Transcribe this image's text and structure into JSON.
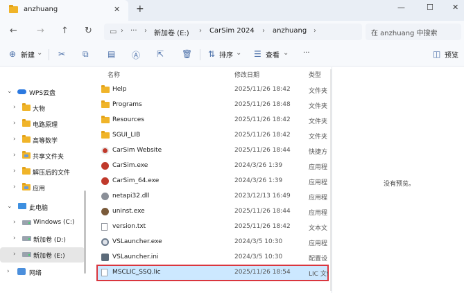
{
  "window": {
    "tab_title": "anzhuang",
    "close_tab": "✕",
    "new_tab": "+",
    "min": "—",
    "max": "☐",
    "close": "✕"
  },
  "nav": {
    "more": "···",
    "breadcrumb": [
      "新加卷 (E:)",
      "CarSim 2024",
      "anzhuang"
    ],
    "search_placeholder": "在 anzhuang 中搜索"
  },
  "toolbar": {
    "new_label": "新建",
    "sort_label": "排序",
    "view_label": "查看",
    "more_label": "···",
    "preview_label": "预览"
  },
  "sidebar": {
    "items": [
      {
        "label": "WPS云盘"
      },
      {
        "label": "大物"
      },
      {
        "label": "电路原理"
      },
      {
        "label": "高等数学"
      },
      {
        "label": "共享文件夹"
      },
      {
        "label": "解压后的文件"
      },
      {
        "label": "应用"
      },
      {
        "label": "此电脑"
      },
      {
        "label": "Windows (C:)"
      },
      {
        "label": "新加卷 (D:)"
      },
      {
        "label": "新加卷 (E:)"
      },
      {
        "label": "网络"
      }
    ]
  },
  "files": {
    "col_name": "名称",
    "col_date": "修改日期",
    "col_type": "类型",
    "rows": [
      {
        "name": "Help",
        "date": "2025/11/26 18:42",
        "type": "文件夹"
      },
      {
        "name": "Programs",
        "date": "2025/11/26 18:48",
        "type": "文件夹"
      },
      {
        "name": "Resources",
        "date": "2025/11/26 18:42",
        "type": "文件夹"
      },
      {
        "name": "SGUI_LIB",
        "date": "2025/11/26 18:42",
        "type": "文件夹"
      },
      {
        "name": "CarSim Website",
        "date": "2025/11/26 18:44",
        "type": "快捷方"
      },
      {
        "name": "CarSim.exe",
        "date": "2024/3/26 1:39",
        "type": "应用程"
      },
      {
        "name": "CarSim_64.exe",
        "date": "2024/3/26 1:39",
        "type": "应用程"
      },
      {
        "name": "netapi32.dll",
        "date": "2023/12/13 16:49",
        "type": "应用程"
      },
      {
        "name": "uninst.exe",
        "date": "2025/11/26 18:44",
        "type": "应用程"
      },
      {
        "name": "version.txt",
        "date": "2025/11/26 18:42",
        "type": "文本文"
      },
      {
        "name": "VSLauncher.exe",
        "date": "2024/3/5 10:30",
        "type": "应用程"
      },
      {
        "name": "VSLauncher.ini",
        "date": "2024/3/5 10:30",
        "type": "配置设"
      },
      {
        "name": "MSCLIC_SSQ.lic",
        "date": "2025/11/26 18:54",
        "type": "LIC 文件"
      }
    ]
  },
  "preview": {
    "empty_text": "没有预览。"
  },
  "colors": {
    "accent": "#0067c0",
    "selection": "#cce8ff",
    "highlight_border": "#d9363e",
    "folder": "#f0b429"
  }
}
